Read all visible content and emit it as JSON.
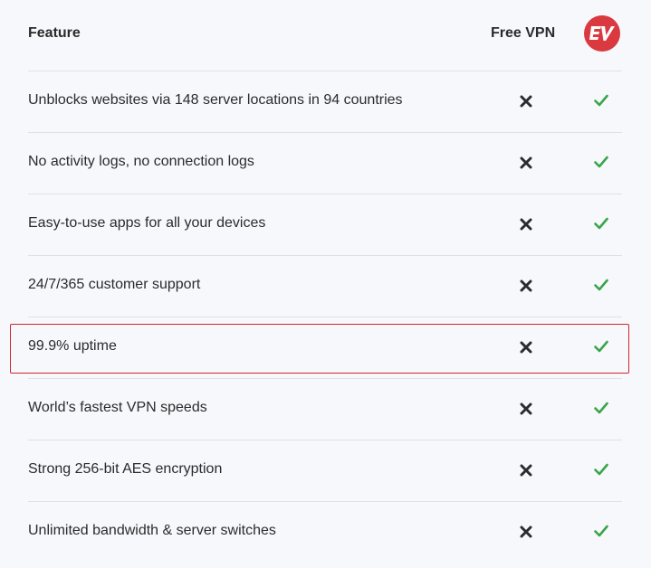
{
  "header": {
    "feature_label": "Feature",
    "free_vpn_label": "Free VPN",
    "brand_logo_icon": "expressvpn-logo-icon",
    "brand_color": "#da3940"
  },
  "rows": [
    {
      "label": "Unblocks websites via 148 server locations in 94 countries",
      "free_vpn": "cross-icon",
      "brand": "check-icon"
    },
    {
      "label": "No activity logs, no connection logs",
      "free_vpn": "cross-icon",
      "brand": "check-icon"
    },
    {
      "label": "Easy-to-use apps for all your devices",
      "free_vpn": "cross-icon",
      "brand": "check-icon"
    },
    {
      "label": "24/7/365 customer support",
      "free_vpn": "cross-icon",
      "brand": "check-icon"
    },
    {
      "label": "99.9% uptime",
      "free_vpn": "cross-icon",
      "brand": "check-icon",
      "highlighted": true
    },
    {
      "label": "World’s fastest VPN speeds",
      "free_vpn": "cross-icon",
      "brand": "check-icon"
    },
    {
      "label": "Strong 256-bit AES encryption",
      "free_vpn": "cross-icon",
      "brand": "check-icon"
    },
    {
      "label": "Unlimited bandwidth & server switches",
      "free_vpn": "cross-icon",
      "brand": "check-icon"
    }
  ],
  "colors": {
    "check": "#3aa54a",
    "cross": "#2b2b2b",
    "highlight_border": "#d0262c",
    "background": "#f7f8fc"
  }
}
